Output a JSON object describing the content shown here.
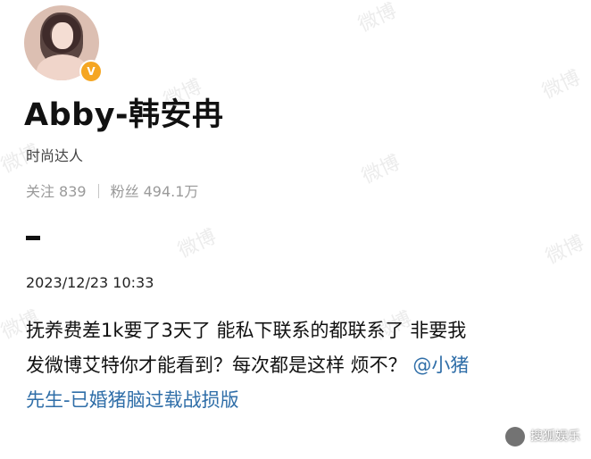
{
  "watermark": "微博",
  "profile": {
    "name": "Abby-韩安冉",
    "title": "时尚达人",
    "verified_badge": "V",
    "following_label": "关注",
    "following_count": "839",
    "followers_label": "粉丝",
    "followers_count": "494.1万",
    "badge_color": "#f5a623"
  },
  "post": {
    "timestamp": "2023/12/23 10:33",
    "text": "抚养费差1k要了3天了 能私下联系的都联系了 非要我\n发微博艾特你才能看到？每次都是这样 烦不？",
    "mention": "@小猪\n先生-已婚猪脑过载战损版",
    "mention_color": "#2f6ea8"
  },
  "source_mark": "搜狐娱乐"
}
